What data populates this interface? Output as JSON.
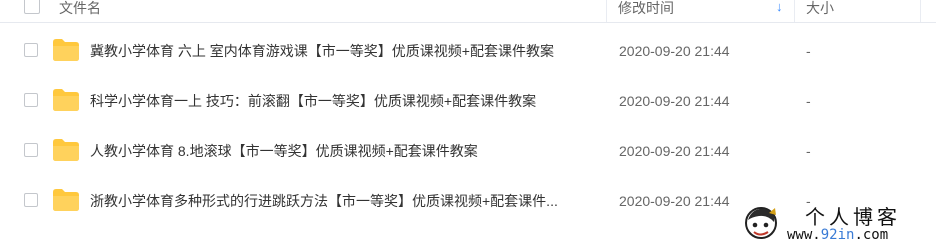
{
  "header": {
    "col_name": "文件名",
    "col_modified": "修改时间",
    "col_size": "大小",
    "sort_icon": "arrow-down-icon"
  },
  "files": [
    {
      "name": "冀教小学体育 六上 室内体育游戏课【市一等奖】优质课视频+配套课件教案",
      "modified": "2020-09-20 21:44",
      "size": "-",
      "icon": "folder-icon"
    },
    {
      "name": "科学小学体育一上 技巧：前滚翻【市一等奖】优质课视频+配套课件教案",
      "modified": "2020-09-20 21:44",
      "size": "-",
      "icon": "folder-icon"
    },
    {
      "name": "人教小学体育 8.地滚球【市一等奖】优质课视频+配套课件教案",
      "modified": "2020-09-20 21:44",
      "size": "-",
      "icon": "folder-icon"
    },
    {
      "name": "浙教小学体育多种形式的行进跳跃方法【市一等奖】优质课视频+配套课件...",
      "modified": "2020-09-20 21:44",
      "size": "-",
      "icon": "folder-icon"
    }
  ],
  "watermark": {
    "title": "个人博客",
    "url_prefix": "www.",
    "url_accent": "92in",
    "url_suffix": ".com"
  },
  "colors": {
    "folder": "#ffc83d",
    "accent": "#3b8cff"
  }
}
